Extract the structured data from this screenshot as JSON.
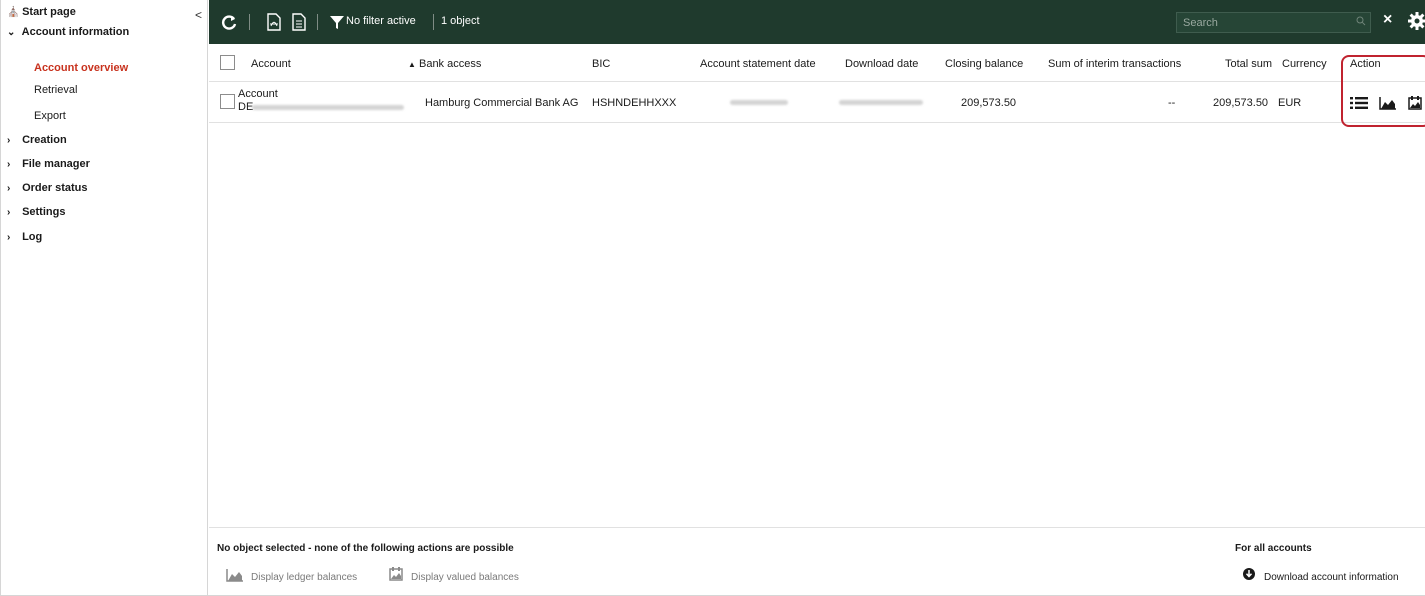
{
  "sidebar": {
    "items": [
      {
        "label": "Start page"
      },
      {
        "label": "Account information"
      },
      {
        "label": "Account overview"
      },
      {
        "label": "Retrieval"
      },
      {
        "label": "Export"
      },
      {
        "label": "Creation"
      },
      {
        "label": "File manager"
      },
      {
        "label": "Order status"
      },
      {
        "label": "Settings"
      },
      {
        "label": "Log"
      }
    ],
    "collapse_glyph": "<"
  },
  "toolbar": {
    "filter_label": "No filter active",
    "object_count": "1 object",
    "search_placeholder": "Search",
    "close_glyph": "×"
  },
  "table": {
    "columns": [
      "Account",
      "Bank access",
      "BIC",
      "Account statement date",
      "Download date",
      "Closing balance",
      "Sum of interim transactions",
      "Total sum",
      "Currency",
      "Action"
    ],
    "sorted_column": "Bank access",
    "rows": [
      {
        "account_name": "Account",
        "account_iban_prefix": "DE",
        "bank_access": "Hamburg Commercial Bank AG",
        "bic": "HSHNDEHHXXX",
        "closing_balance": "209,573.50",
        "interim_sum": "--",
        "total_sum": "209,573.50",
        "currency": "EUR"
      }
    ]
  },
  "footer": {
    "no_selection_text": "No object selected - none of the following actions are possible",
    "display_ledger_label": "Display ledger balances",
    "display_valued_label": "Display valued balances",
    "all_accounts_title": "For all accounts",
    "download_label": "Download account information"
  },
  "colors": {
    "toolbar_bg": "#1f3a2d",
    "active_nav": "#c8321e",
    "highlight_border": "#c0232f"
  }
}
